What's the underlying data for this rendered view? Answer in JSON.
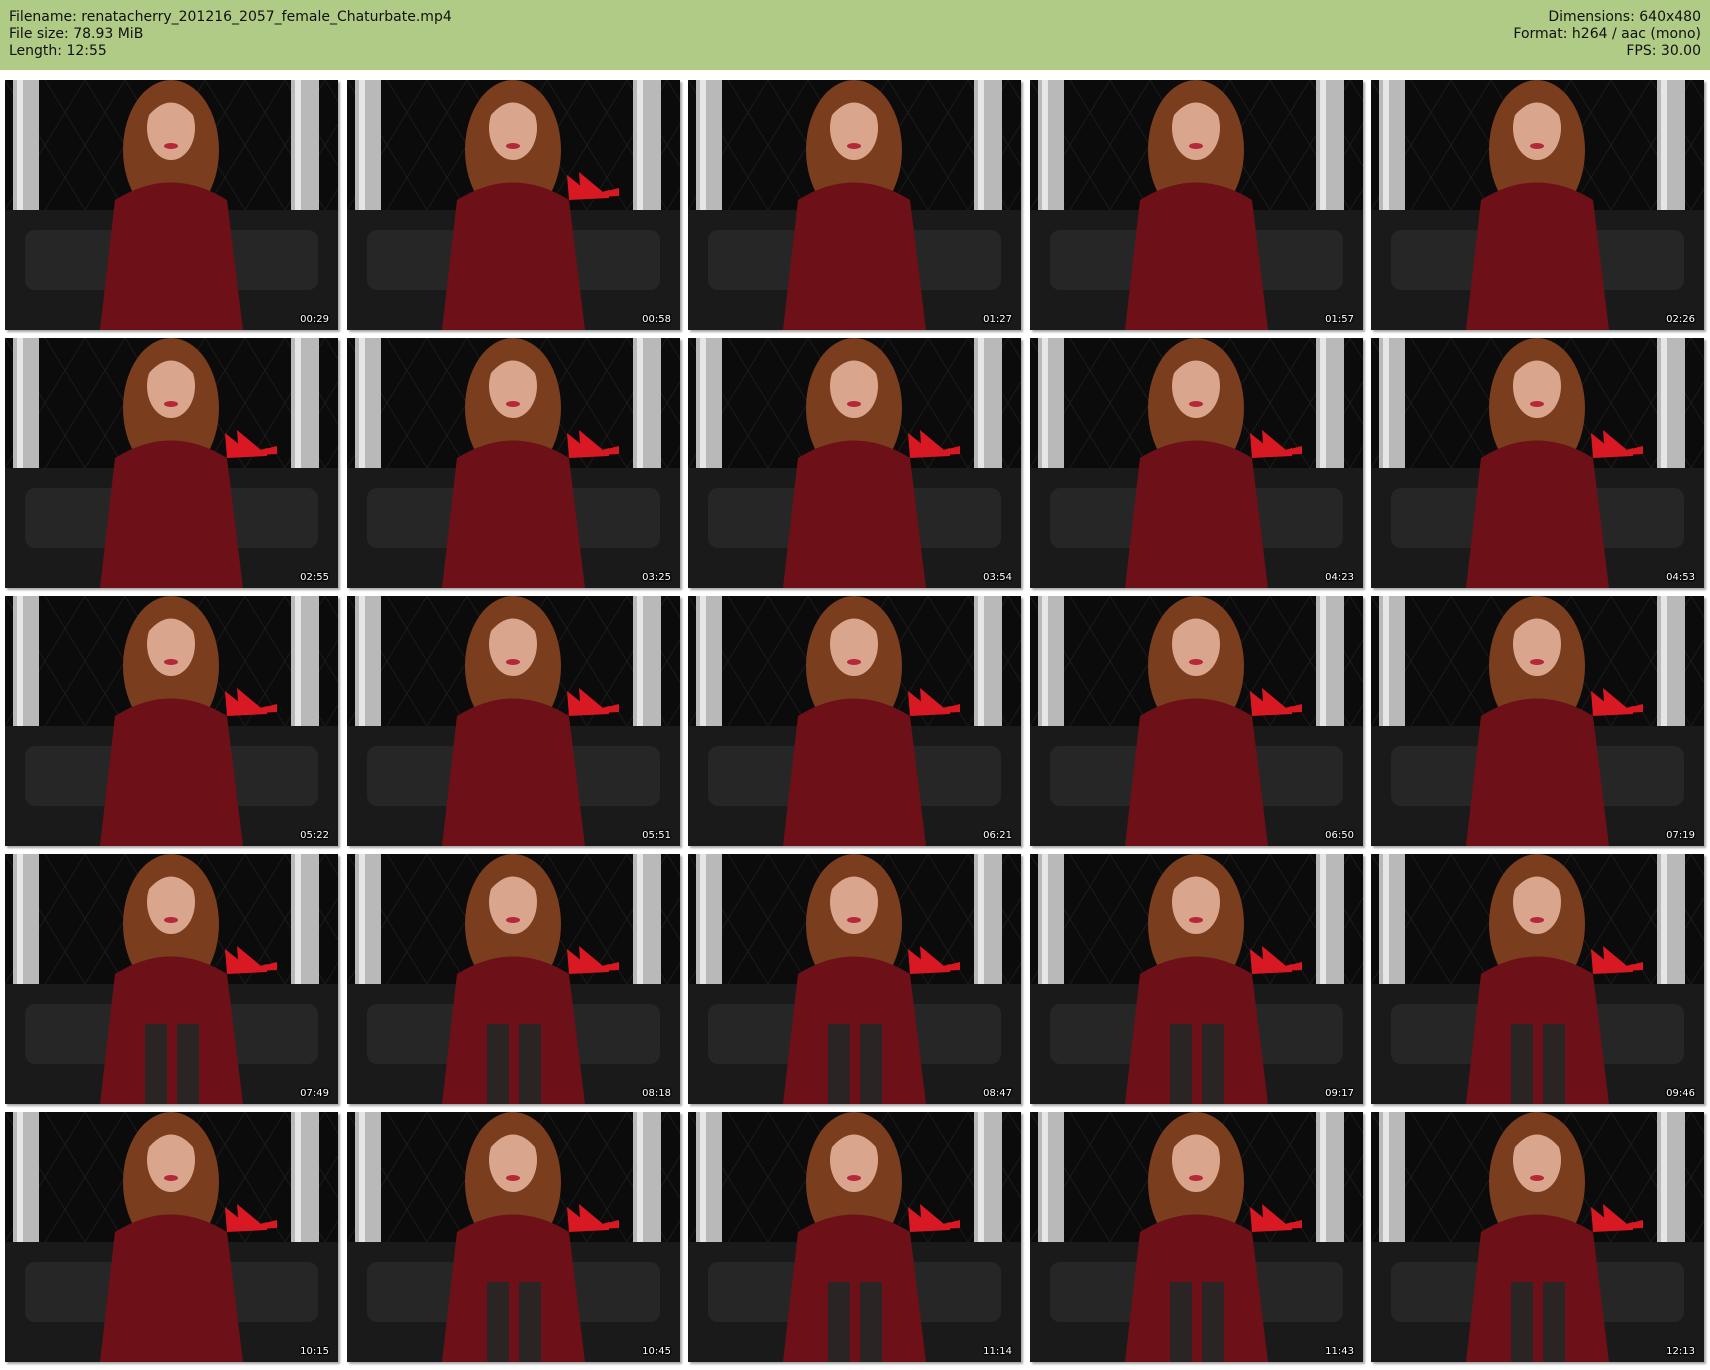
{
  "header": {
    "filename_line": "Filename: renatacherry_201216_2057_female_Chaturbate.mp4",
    "filesize_line": "File size: 78.93 MiB",
    "length_line": "Length: 12:55",
    "dimensions_line": "Dimensions: 640x480",
    "format_line": "Format: h264 / aac (mono)",
    "fps_line": "FPS: 30.00"
  },
  "colors": {
    "header_bg": "#b0cb85",
    "dress": "#6e1018",
    "backdrop": "#0b0b0b",
    "pillar": "#b9b9b9",
    "shoes": "#d81822",
    "hair": "#7a3d1e",
    "skin": "#d9a58c"
  },
  "frames": [
    {
      "time": "00:29",
      "shoes": false,
      "legs": false
    },
    {
      "time": "00:58",
      "shoes": true,
      "legs": false
    },
    {
      "time": "01:27",
      "shoes": false,
      "legs": false
    },
    {
      "time": "01:57",
      "shoes": false,
      "legs": false
    },
    {
      "time": "02:26",
      "shoes": false,
      "legs": false
    },
    {
      "time": "02:55",
      "shoes": true,
      "legs": false
    },
    {
      "time": "03:25",
      "shoes": true,
      "legs": false
    },
    {
      "time": "03:54",
      "shoes": true,
      "legs": false
    },
    {
      "time": "04:23",
      "shoes": true,
      "legs": false
    },
    {
      "time": "04:53",
      "shoes": true,
      "legs": false
    },
    {
      "time": "05:22",
      "shoes": true,
      "legs": false
    },
    {
      "time": "05:51",
      "shoes": true,
      "legs": false
    },
    {
      "time": "06:21",
      "shoes": true,
      "legs": false
    },
    {
      "time": "06:50",
      "shoes": true,
      "legs": false
    },
    {
      "time": "07:19",
      "shoes": true,
      "legs": false
    },
    {
      "time": "07:49",
      "shoes": true,
      "legs": true
    },
    {
      "time": "08:18",
      "shoes": true,
      "legs": true
    },
    {
      "time": "08:47",
      "shoes": true,
      "legs": true
    },
    {
      "time": "09:17",
      "shoes": true,
      "legs": true
    },
    {
      "time": "09:46",
      "shoes": true,
      "legs": true
    },
    {
      "time": "10:15",
      "shoes": true,
      "legs": false
    },
    {
      "time": "10:45",
      "shoes": true,
      "legs": true
    },
    {
      "time": "11:14",
      "shoes": true,
      "legs": true
    },
    {
      "time": "11:43",
      "shoes": true,
      "legs": true
    },
    {
      "time": "12:13",
      "shoes": true,
      "legs": true
    }
  ]
}
